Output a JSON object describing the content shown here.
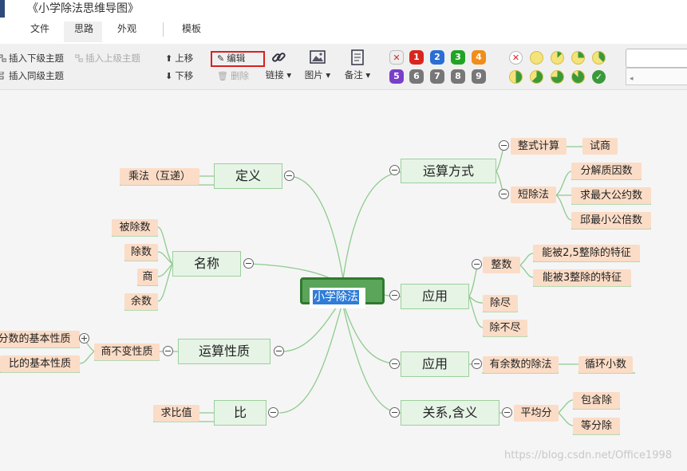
{
  "window": {
    "title": "《小学除法思维导图》"
  },
  "tabs": [
    {
      "label": "文件"
    },
    {
      "label": "思路",
      "active": true
    },
    {
      "label": "外观"
    },
    {
      "label": "模板"
    }
  ],
  "toolbar": {
    "insert_child": "插入下级主题",
    "insert_parent": "插入上级主题",
    "insert_sibling": "插入同级主题",
    "move_up": "上移",
    "move_down": "下移",
    "edit": "编辑",
    "delete": "删除",
    "link": "链接",
    "image": "图片",
    "note": "备注",
    "priority_badges": [
      "1",
      "2",
      "3",
      "4",
      "5",
      "6",
      "7",
      "8",
      "9"
    ],
    "progress_icons": [
      "clear",
      "0%",
      "12.5%",
      "25%",
      "37.5%",
      "50%",
      "62.5%",
      "75%",
      "87.5%",
      "100%"
    ]
  },
  "colors": {
    "accent_red": "#d92020",
    "node_fill": "#e6f4e6",
    "leaf_fill": "#fbdcc6",
    "central_fill": "#5aa55a",
    "line": "#8dcb8d"
  },
  "mindmap": {
    "central": "小学除法",
    "left": [
      {
        "label": "定义",
        "children": [
          "乘法（互递）"
        ]
      },
      {
        "label": "名称",
        "children": [
          "被除数",
          "除数",
          "商",
          "余数"
        ]
      },
      {
        "label": "运算性质",
        "children": [
          {
            "label": "商不变性质",
            "children": [
              "分数的基本性质",
              "比的基本性质"
            ]
          }
        ]
      },
      {
        "label": "比",
        "children": [
          "求比值"
        ]
      }
    ],
    "right": [
      {
        "label": "运算方式",
        "children": [
          {
            "label": "整式计算",
            "children": [
              "试商"
            ]
          },
          {
            "label": "短除法",
            "children": [
              "分解质因数",
              "求最大公约数",
              "邱最小公倍数"
            ]
          }
        ]
      },
      {
        "label": "应用",
        "children": [
          {
            "label": "整数",
            "children": [
              "能被2,5整除的特征",
              "能被3整除的特征"
            ]
          },
          "除尽",
          "除不尽"
        ]
      },
      {
        "label": "应用",
        "children": [
          {
            "label": "有余数的除法",
            "children": [
              "循环小数"
            ]
          }
        ]
      },
      {
        "label": "关系,含义",
        "children": [
          {
            "label": "平均分",
            "children": [
              "包含除",
              "等分除"
            ]
          }
        ]
      }
    ]
  },
  "watermark": "https://blog.csdn.net/Office1998"
}
